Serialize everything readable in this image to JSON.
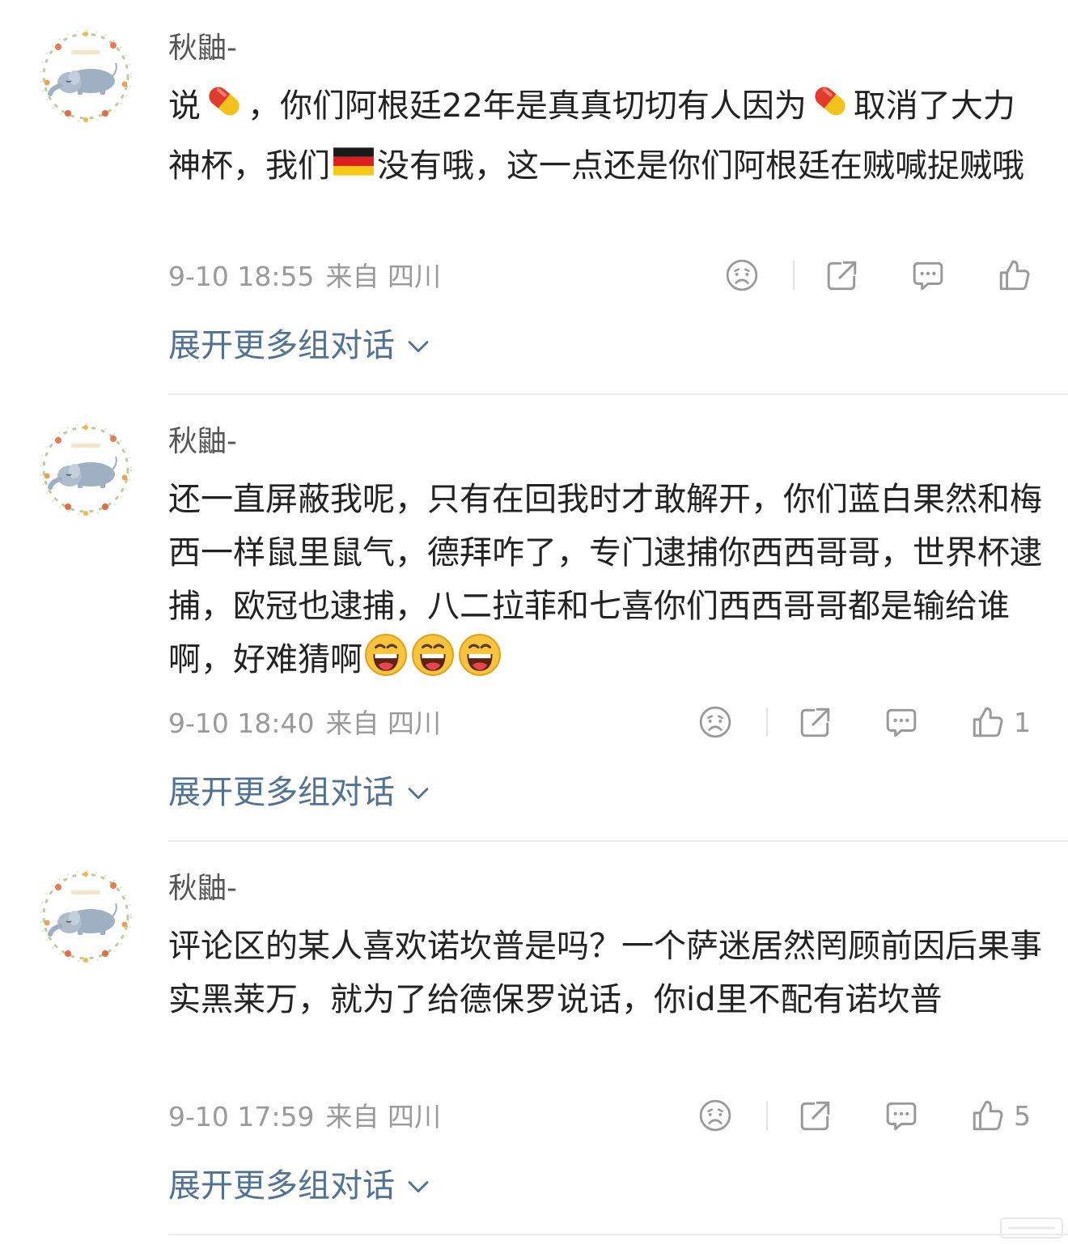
{
  "colors": {
    "username": "#555555",
    "content": "#222222",
    "meta": "#9a9a9a",
    "link": "#4f7296",
    "icon": "#999999"
  },
  "comments": [
    {
      "username": "秋鼬-",
      "segments": [
        {
          "t": "说"
        },
        {
          "icon": "pill-emoji"
        },
        {
          "t": "，你们阿根廷22年是真真切切有人因为"
        },
        {
          "icon": "pill-emoji"
        },
        {
          "t": "取消了大力神杯，我们"
        },
        {
          "icon": "germany-flag-emoji"
        },
        {
          "t": "没有哦，这一点还是你们阿根廷在贼喊捉贼哦"
        }
      ],
      "time": "9-10 18:55",
      "source": "来自 四川",
      "likes": "",
      "expand_label": "展开更多组对话"
    },
    {
      "username": "秋鼬-",
      "segments": [
        {
          "t": "还一直屏蔽我呢，只有在回我时才敢解开，你们蓝白果然和梅西一样鼠里鼠气，德拜咋了，专门逮捕你西西哥哥，世界杯逮捕，欧冠也逮捕，八二拉菲和七喜你们西西哥哥都是输给谁啊，好难猜啊"
        },
        {
          "icon": "laughing-emoji"
        },
        {
          "icon": "laughing-emoji"
        },
        {
          "icon": "laughing-emoji"
        }
      ],
      "time": "9-10 18:40",
      "source": "来自 四川",
      "likes": "1",
      "expand_label": "展开更多组对话"
    },
    {
      "username": "秋鼬-",
      "segments": [
        {
          "t": "评论区的某人喜欢诺坎普是吗？一个萨迷居然罔顾前因后果事实黑莱万，就为了给德保罗说话，你id里不配有诺坎普"
        }
      ],
      "time": "9-10 17:59",
      "source": "来自 四川",
      "likes": "5",
      "expand_label": "展开更多组对话"
    }
  ],
  "icons": {
    "dislike": "sad-face-icon",
    "share": "share-icon",
    "reply": "comment-icon",
    "like": "thumbs-up-icon",
    "expand": "chevron-down-icon"
  }
}
